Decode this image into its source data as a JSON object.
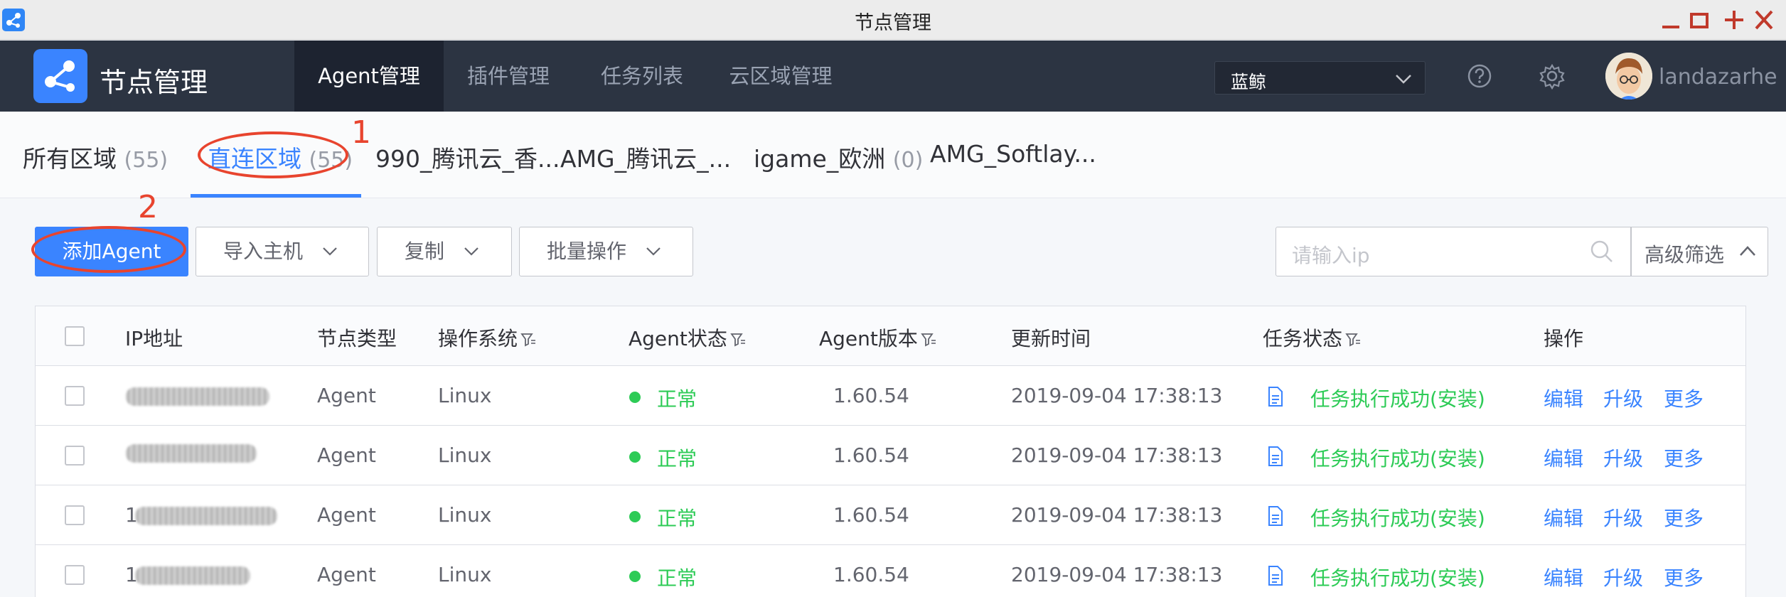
{
  "window": {
    "title": "节点管理"
  },
  "app": {
    "title": "节点管理"
  },
  "nav": {
    "items": [
      {
        "label": "Agent管理",
        "active": true
      },
      {
        "label": "插件管理"
      },
      {
        "label": "任务列表"
      },
      {
        "label": "云区域管理"
      }
    ],
    "business_select": "蓝鲸",
    "username": "landazarhe"
  },
  "area_tabs": [
    {
      "label": "所有区域",
      "count": "(55)"
    },
    {
      "label": "直连区域",
      "count": "(55)",
      "active": true
    },
    {
      "label": "990_腾讯云_香...",
      "count": ""
    },
    {
      "label": "AMG_腾讯云_...",
      "count": ""
    },
    {
      "label": "igame_欧洲",
      "count": "(0)"
    },
    {
      "label": "AMG_Softlay...",
      "count": ""
    }
  ],
  "annotations": {
    "one": "1",
    "two": "2"
  },
  "toolbar": {
    "add_agent": "添加Agent",
    "import_host": "导入主机",
    "copy": "复制",
    "batch": "批量操作",
    "search_placeholder": "请输入ip",
    "advanced_filter": "高级筛选"
  },
  "table": {
    "headers": {
      "ip": "IP地址",
      "node_type": "节点类型",
      "os": "操作系统",
      "agent_status": "Agent状态",
      "agent_version": "Agent版本",
      "update_time": "更新时间",
      "task_status": "任务状态",
      "actions": "操作"
    },
    "rows": [
      {
        "ip_prefix": "",
        "node_type": "Agent",
        "os": "Linux",
        "status": "正常",
        "version": "1.60.54",
        "time": "2019-09-04 17:38:13",
        "task": "任务执行成功(安装)",
        "edit": "编辑",
        "upgrade": "升级",
        "more": "更多"
      },
      {
        "ip_prefix": "",
        "node_type": "Agent",
        "os": "Linux",
        "status": "正常",
        "version": "1.60.54",
        "time": "2019-09-04 17:38:13",
        "task": "任务执行成功(安装)",
        "edit": "编辑",
        "upgrade": "升级",
        "more": "更多"
      },
      {
        "ip_prefix": "1",
        "node_type": "Agent",
        "os": "Linux",
        "status": "正常",
        "version": "1.60.54",
        "time": "2019-09-04 17:38:13",
        "task": "任务执行成功(安装)",
        "edit": "编辑",
        "upgrade": "升级",
        "more": "更多"
      },
      {
        "ip_prefix": "1",
        "node_type": "Agent",
        "os": "Linux",
        "status": "正常",
        "version": "1.60.54",
        "time": "2019-09-04 17:38:13",
        "task": "任务执行成功(安装)",
        "edit": "编辑",
        "upgrade": "升级",
        "more": "更多"
      }
    ]
  },
  "colors": {
    "primary": "#3a84ff",
    "success": "#2dcb56",
    "nav_bg": "#2c3442",
    "annotation": "#e8442e"
  }
}
